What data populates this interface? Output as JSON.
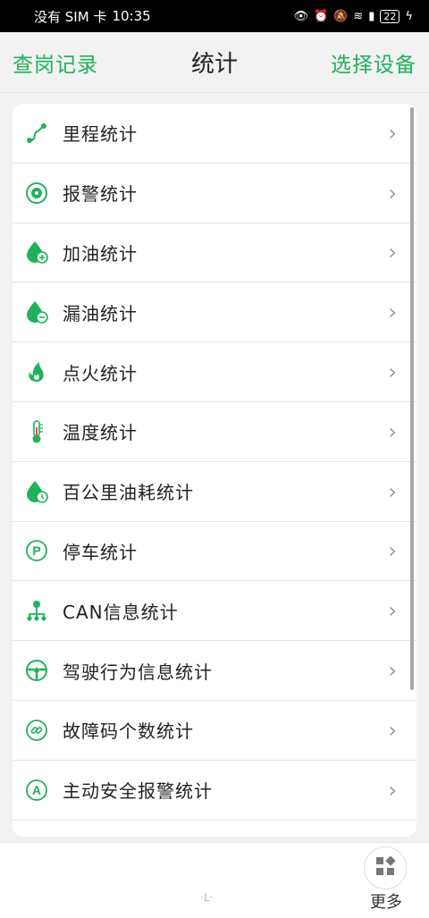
{
  "status_bar": {
    "carrier": "没有 SIM 卡",
    "time": "10:35",
    "battery": "22"
  },
  "header": {
    "left_link": "查岗记录",
    "title": "统计",
    "right_link": "选择设备"
  },
  "accent_color": "#1fb25a",
  "items": [
    {
      "label": "里程统计",
      "icon": "route-icon"
    },
    {
      "label": "报警统计",
      "icon": "alarm-icon"
    },
    {
      "label": "加油统计",
      "icon": "fuel-add-icon"
    },
    {
      "label": "漏油统计",
      "icon": "fuel-leak-icon"
    },
    {
      "label": "点火统计",
      "icon": "fire-icon"
    },
    {
      "label": "温度统计",
      "icon": "thermometer-icon"
    },
    {
      "label": "百公里油耗统计",
      "icon": "fuel-consumption-icon"
    },
    {
      "label": "停车统计",
      "icon": "parking-icon"
    },
    {
      "label": "CAN信息统计",
      "icon": "network-icon"
    },
    {
      "label": "驾驶行为信息统计",
      "icon": "steering-wheel-icon"
    },
    {
      "label": "故障码个数统计",
      "icon": "link-icon"
    },
    {
      "label": "主动安全报警统计",
      "icon": "active-safety-icon"
    }
  ],
  "bottom": {
    "more_label": "更多"
  }
}
